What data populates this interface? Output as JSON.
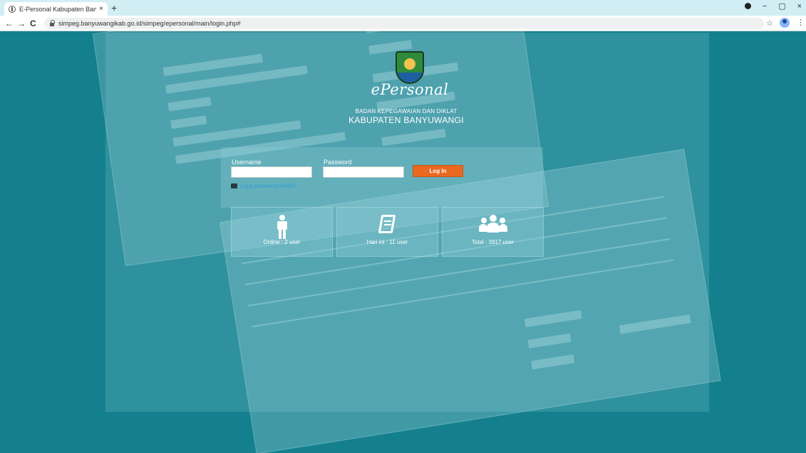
{
  "browser": {
    "tab_title": "E-Personal Kabupaten Banyuwa...",
    "tab_close": "×",
    "new_tab": "+",
    "url": "simpeg.banyuwangikab.go.id/simpeg/epersonal/main/login.php#",
    "back": "←",
    "forward": "→",
    "reload": "C",
    "minimize": "−",
    "restore": "▢",
    "close": "×",
    "star": "☆",
    "menu": "⋮"
  },
  "header": {
    "brand": "ePersonal",
    "agency": "BADAN KEPEGAWAIAN DAN DIKLAT",
    "regency": "KABUPATEN BANYUWANGI"
  },
  "login": {
    "username_label": "Username",
    "password_label": "Password",
    "username_value": "",
    "password_value": "",
    "button_label": "Log In",
    "forgot_label": "Lupa password Anda?"
  },
  "stats": {
    "online": "Online : 2 user",
    "today": "Hari ini : 11 user",
    "total": "Total : 3917 user"
  },
  "colors": {
    "page_bg": "#14808e",
    "accent_button": "#e8691f"
  }
}
